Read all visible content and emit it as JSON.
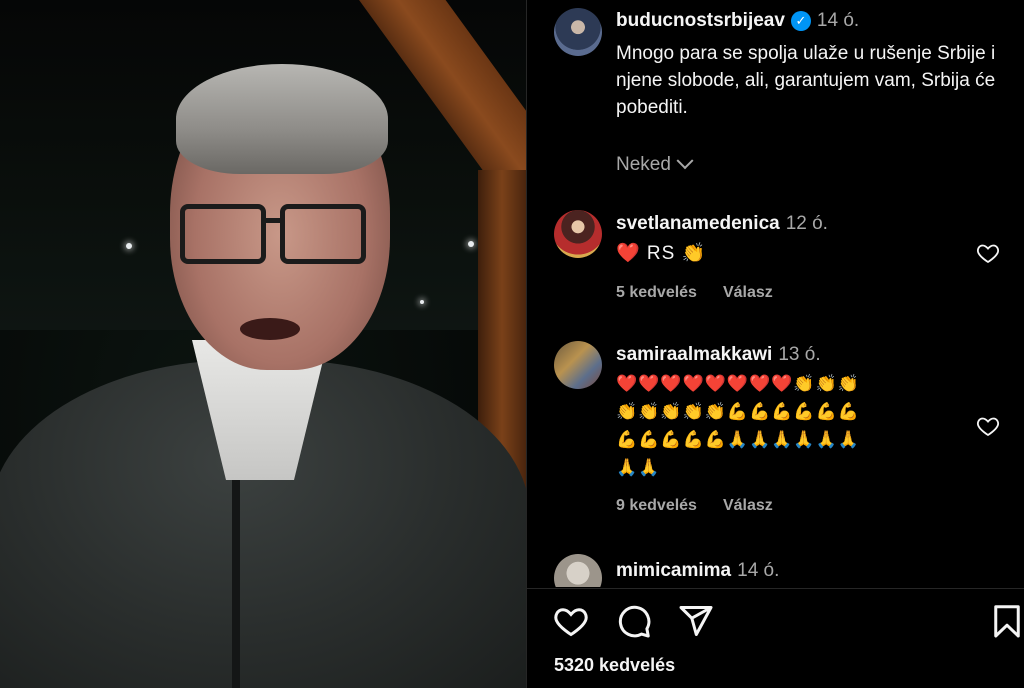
{
  "post": {
    "author": "buducnostsrbijeav",
    "time": "14 ó.",
    "caption": "Mnogo para se spolja ulaže u rušenje Srbije i njene slobode, ali, garantujem vam, Srbija će pobediti.",
    "translate_label": "Neked",
    "likes": "5320 kedvelés"
  },
  "comments": [
    {
      "user": "svetlanamedenica",
      "time": "12 ó.",
      "text": "❤️ RS 👏",
      "likes": "5 kedvelés",
      "reply": "Válasz"
    },
    {
      "user": "samiraalmakkawi",
      "time": "13 ó.",
      "text_lines": [
        "❤️❤️❤️❤️❤️❤️❤️❤️👏👏👏",
        "👏👏👏👏👏💪💪💪💪💪💪",
        "💪💪💪💪💪🙏🙏🙏🙏🙏🙏",
        "🙏🙏"
      ],
      "likes": "9 kedvelés",
      "reply": "Válasz"
    },
    {
      "user": "mimicamima",
      "time": "14 ó."
    }
  ],
  "icons": {
    "verified": "verified-badge-icon",
    "like": "heart-icon",
    "comment": "comment-icon",
    "share": "send-icon",
    "save": "bookmark-icon"
  },
  "colors": {
    "background": "#000000",
    "text": "#f5f5f5",
    "secondary": "#a8a8a8",
    "verified": "#0095f6",
    "heart": "#ff3040"
  }
}
